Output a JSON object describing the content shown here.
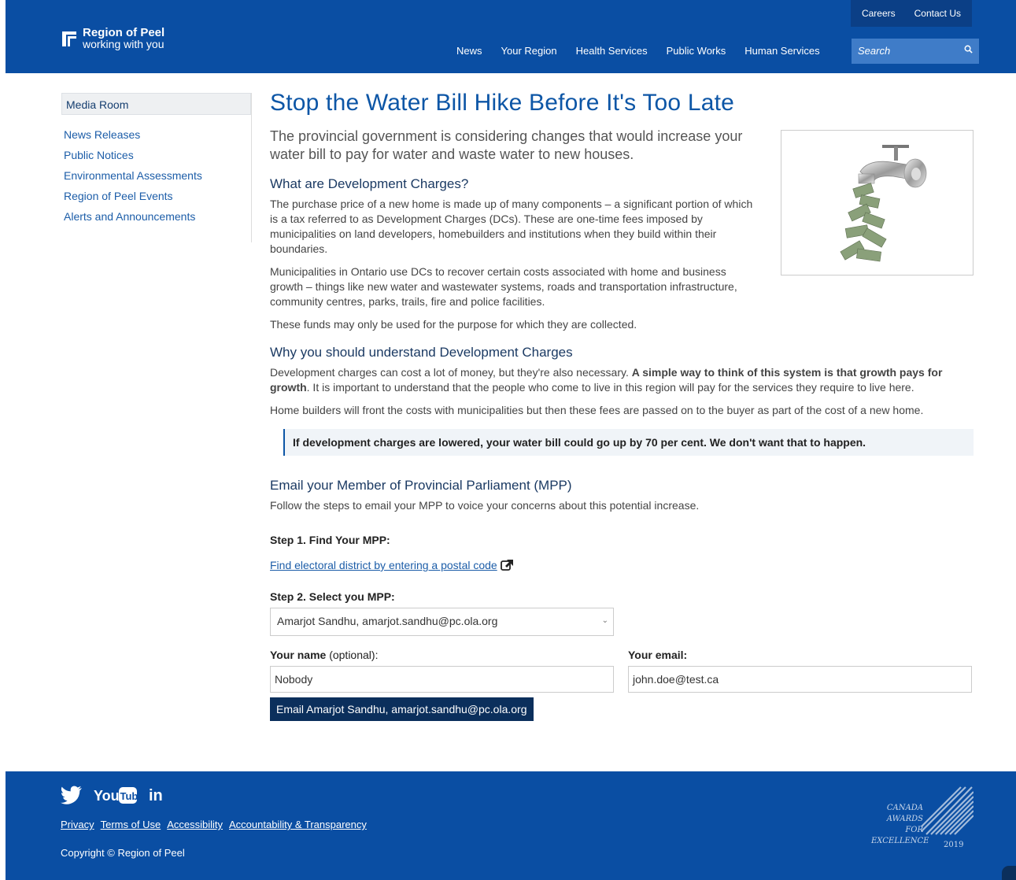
{
  "header": {
    "logo_title": "Region of Peel",
    "logo_sub": "working with you",
    "top_links": [
      "Careers",
      "Contact Us"
    ],
    "nav": [
      "News",
      "Your Region",
      "Health Services",
      "Public Works",
      "Human Services"
    ],
    "search_placeholder": "Search"
  },
  "sidebar": {
    "heading": "Media Room",
    "items": [
      "News Releases",
      "Public Notices",
      "Environmental Assessments",
      "Region of Peel Events",
      "Alerts and Announcements"
    ]
  },
  "main": {
    "title": "Stop the Water Bill Hike Before It's Too Late",
    "lead": "The provincial government is considering changes that would increase your water bill to pay for water and waste water to new houses.",
    "sec1_title": "What are Development Charges?",
    "sec1_p1": "The purchase price of a new home is made up of many components – a significant portion of which is a tax referred to as Development Charges (DCs). These are one-time fees imposed by municipalities on land developers, homebuilders and institutions when they build within their boundaries.",
    "sec1_p2": "Municipalities in Ontario use DCs to recover certain costs associated with home and business growth – things like new water and wastewater systems, roads and transportation infrastructure, community centres, parks, trails, fire and police facilities.",
    "sec1_p3": "These funds may only be used for the purpose for which they are collected.",
    "sec2_title": "Why you should understand Development Charges",
    "sec2_p1_a": "Development charges can cost a lot of money, but they're also necessary. ",
    "sec2_p1_b": "A simple way to think of this system is that growth pays for growth",
    "sec2_p1_c": ". It is important to understand that the people who come to live in this region will pay for the services they require to live here.",
    "sec2_p2": "Home builders will front the costs with municipalities but then these fees are passed on to the buyer as part of the cost of a new home.",
    "callout": "If development charges are lowered, your water bill could go up by 70 per cent. We don't want that to happen.",
    "sec3_title": "Email your Member of Provincial Parliament (MPP)",
    "sec3_p": "Follow the steps to email your MPP to voice your concerns about this potential increase.",
    "step1": "Step 1. Find Your MPP:",
    "step1_link": "Find electoral district by entering a postal code",
    "step2": "Step 2. Select you MPP:",
    "mpp_selected": "Amarjot Sandhu, amarjot.sandhu@pc.ola.org",
    "name_label": "Your name",
    "name_opt": " (optional):",
    "name_value": "Nobody",
    "email_label": "Your email:",
    "email_value": "john.doe@test.ca",
    "send_button": "Email Amarjot Sandhu, amarjot.sandhu@pc.ola.org"
  },
  "footer": {
    "social": [
      "Twitter",
      "YouTube",
      "LinkedIn"
    ],
    "links": [
      "Privacy",
      "Terms of Use",
      "Accessibility",
      "Accountability & Transparency"
    ],
    "copyright": "Copyright © Region of Peel",
    "award_lines": [
      "CANADA",
      "AWARDS FOR",
      "EXCELLENCE"
    ],
    "award_year": "2019"
  },
  "colors": {
    "brand": "#0a4ea3",
    "button": "#0b2f5c",
    "link": "#1c5da8"
  }
}
